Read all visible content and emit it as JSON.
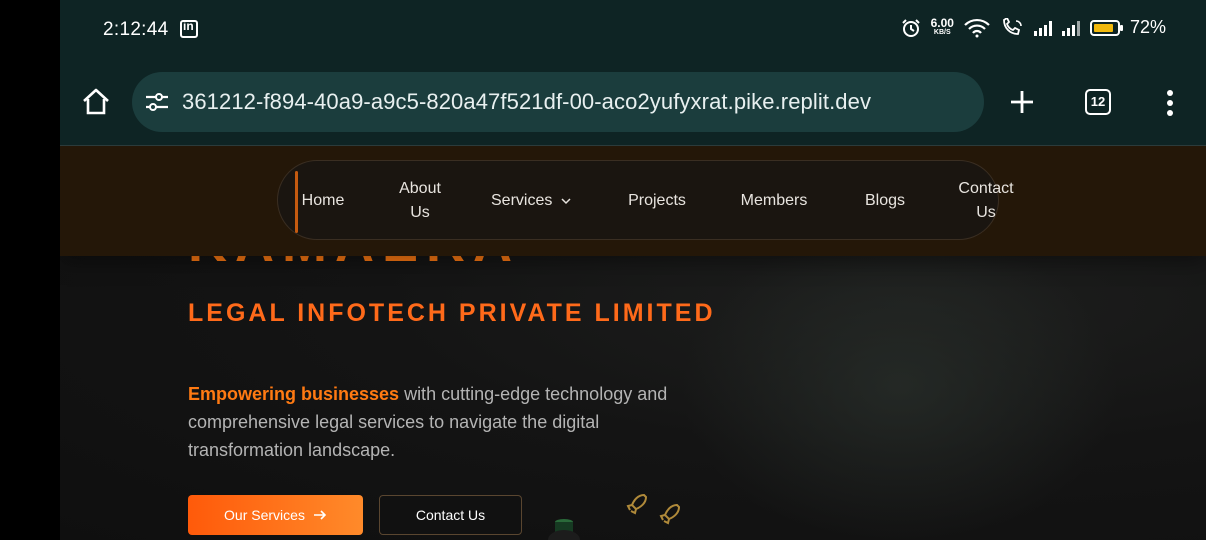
{
  "status_bar": {
    "time": "2:12:44",
    "net_speed": "6.00",
    "net_unit": "KB/S",
    "battery": "72%",
    "battery_level": 0.72,
    "icons": [
      "linkedin-icon",
      "alarm-icon",
      "wifi-icon",
      "wifi-calling-icon",
      "signal-icon",
      "signal-roaming-icon",
      "battery-icon"
    ]
  },
  "browser": {
    "url": "361212-f894-40a9-a9c5-820a47f521df-00-aco2yufyxrat.pike.replit.dev",
    "tab_count": "12",
    "theme_color": "#0e2424",
    "urlbar_color": "#1b3d3d"
  },
  "site": {
    "brand_partial": "KAMAERA",
    "subtitle": "LEGAL INFOTECH PRIVATE LIMITED",
    "tagline_highlight": "Empowering businesses",
    "tagline_rest": " with cutting-edge technology and comprehensive legal services to navigate the digital transformation landscape.",
    "accent_color": "#ff7a12",
    "nav": {
      "home": "Home",
      "about_line1": "About",
      "about_line2": "Us",
      "services": "Services",
      "projects": "Projects",
      "members": "Members",
      "blogs": "Blogs",
      "contact_line1": "Contact",
      "contact_line2": "Us"
    },
    "buttons": {
      "primary": "Our Services",
      "secondary": "Contact Us"
    }
  }
}
